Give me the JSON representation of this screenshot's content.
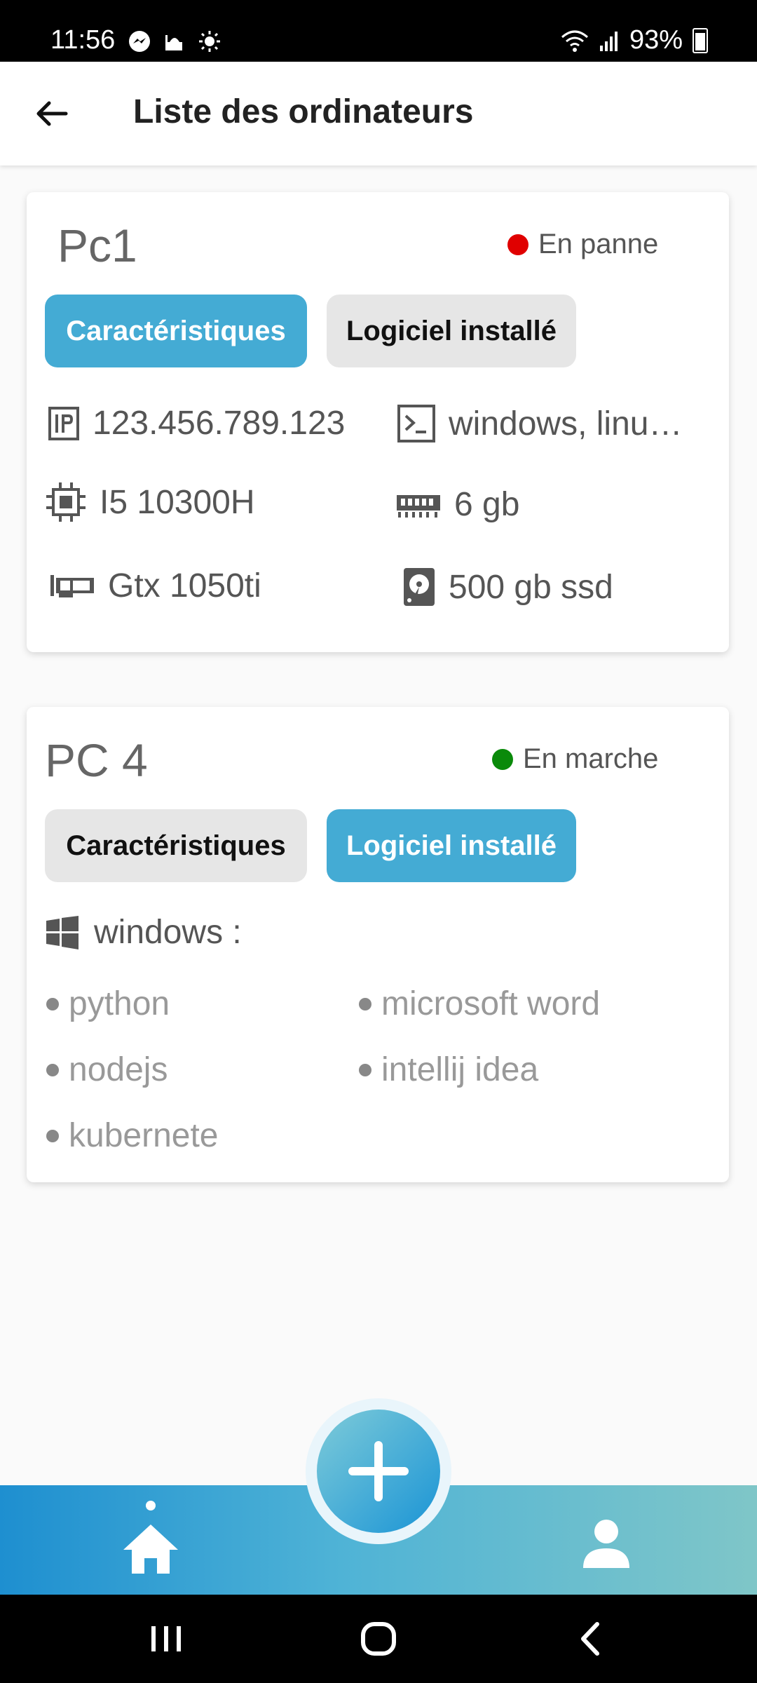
{
  "status_bar": {
    "time": "11:56",
    "battery": "93%",
    "icons_left": [
      "messenger-icon",
      "mosque-icon",
      "brightness-icon"
    ],
    "icons_right": [
      "wifi-icon",
      "signal-icon",
      "battery-icon"
    ]
  },
  "app_bar": {
    "title": "Liste des ordinateurs",
    "back_icon": "arrow-left-icon"
  },
  "cards": [
    {
      "name": "Pc1",
      "status": "En panne",
      "status_color": "#e00000",
      "tabs": [
        "Caractéristiques",
        "Logiciel installé"
      ],
      "active_tab": 0,
      "specs": {
        "ip": "123.456.789.123",
        "os": "windows, linu…",
        "cpu": "I5 10300H",
        "ram": "6 gb",
        "gpu": "Gtx 1050ti",
        "storage": "500 gb ssd"
      }
    },
    {
      "name": "PC 4",
      "status": "En marche",
      "status_color": "#0a8a0a",
      "tabs": [
        "Caractéristiques",
        "Logiciel installé"
      ],
      "active_tab": 1,
      "os_label": "windows :",
      "software": [
        "python",
        "microsoft word",
        "nodejs",
        "intellij idea",
        "kubernete"
      ]
    }
  ],
  "colors": {
    "accent": "#44abd4",
    "nav_gradient_start": "#1e8fd0",
    "nav_gradient_end": "#7fc6c8"
  },
  "bottom_nav": {
    "items": [
      "home-icon",
      "add-icon",
      "profile-icon"
    ],
    "active": "home-icon"
  },
  "system_nav": [
    "recents-icon",
    "home-circle-icon",
    "back-chevron-icon"
  ]
}
